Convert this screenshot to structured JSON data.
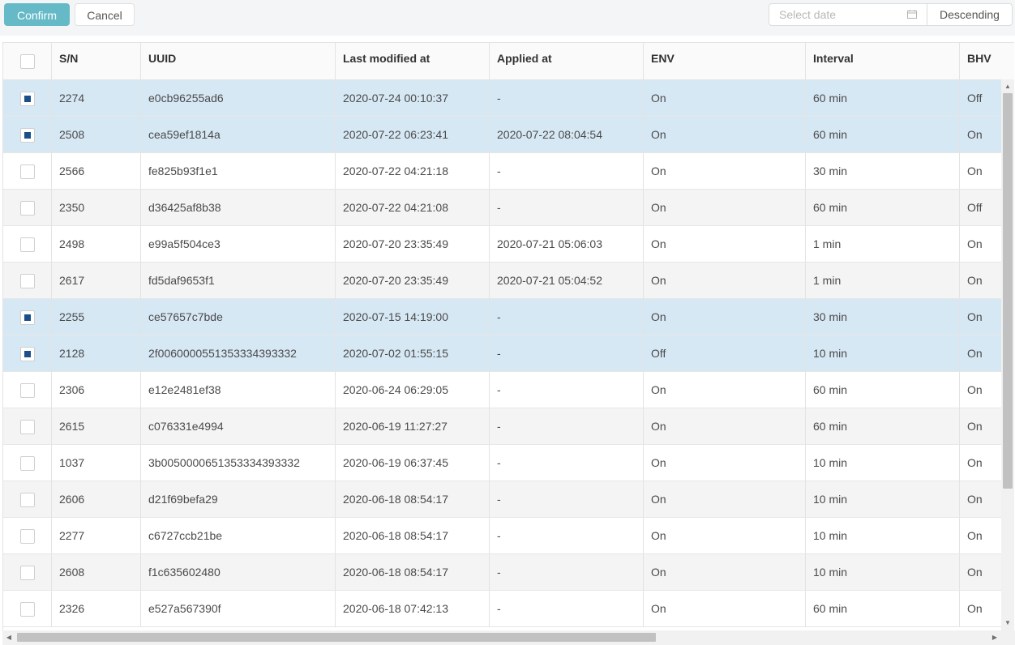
{
  "toolbar": {
    "confirm_label": "Confirm",
    "cancel_label": "Cancel",
    "date_placeholder": "Select date",
    "sort_label": "Descending"
  },
  "table": {
    "columns": [
      "S/N",
      "UUID",
      "Last modified at",
      "Applied at",
      "ENV",
      "Interval",
      "BHV"
    ],
    "rows": [
      {
        "selected": true,
        "sn": "2274",
        "uuid": "e0cb96255ad6",
        "modified": "2020-07-24 00:10:37",
        "applied": "-",
        "env": "On",
        "interval": "60 min",
        "bhv": "Off"
      },
      {
        "selected": true,
        "sn": "2508",
        "uuid": "cea59ef1814a",
        "modified": "2020-07-22 06:23:41",
        "applied": "2020-07-22 08:04:54",
        "env": "On",
        "interval": "60 min",
        "bhv": "On"
      },
      {
        "selected": false,
        "sn": "2566",
        "uuid": "fe825b93f1e1",
        "modified": "2020-07-22 04:21:18",
        "applied": "-",
        "env": "On",
        "interval": "30 min",
        "bhv": "On"
      },
      {
        "selected": false,
        "sn": "2350",
        "uuid": "d36425af8b38",
        "modified": "2020-07-22 04:21:08",
        "applied": "-",
        "env": "On",
        "interval": "60 min",
        "bhv": "Off"
      },
      {
        "selected": false,
        "sn": "2498",
        "uuid": "e99a5f504ce3",
        "modified": "2020-07-20 23:35:49",
        "applied": "2020-07-21 05:06:03",
        "env": "On",
        "interval": "1 min",
        "bhv": "On"
      },
      {
        "selected": false,
        "sn": "2617",
        "uuid": "fd5daf9653f1",
        "modified": "2020-07-20 23:35:49",
        "applied": "2020-07-21 05:04:52",
        "env": "On",
        "interval": "1 min",
        "bhv": "On"
      },
      {
        "selected": true,
        "sn": "2255",
        "uuid": "ce57657c7bde",
        "modified": "2020-07-15 14:19:00",
        "applied": "-",
        "env": "On",
        "interval": "30 min",
        "bhv": "On"
      },
      {
        "selected": true,
        "sn": "2128",
        "uuid": "2f0060000551353334393332",
        "modified": "2020-07-02 01:55:15",
        "applied": "-",
        "env": "Off",
        "interval": "10 min",
        "bhv": "On"
      },
      {
        "selected": false,
        "sn": "2306",
        "uuid": "e12e2481ef38",
        "modified": "2020-06-24 06:29:05",
        "applied": "-",
        "env": "On",
        "interval": "60 min",
        "bhv": "On"
      },
      {
        "selected": false,
        "sn": "2615",
        "uuid": "c076331e4994",
        "modified": "2020-06-19 11:27:27",
        "applied": "-",
        "env": "On",
        "interval": "60 min",
        "bhv": "On"
      },
      {
        "selected": false,
        "sn": "1037",
        "uuid": "3b0050000651353334393332",
        "modified": "2020-06-19 06:37:45",
        "applied": "-",
        "env": "On",
        "interval": "10 min",
        "bhv": "On"
      },
      {
        "selected": false,
        "sn": "2606",
        "uuid": "d21f69befa29",
        "modified": "2020-06-18 08:54:17",
        "applied": "-",
        "env": "On",
        "interval": "10 min",
        "bhv": "On"
      },
      {
        "selected": false,
        "sn": "2277",
        "uuid": "c6727ccb21be",
        "modified": "2020-06-18 08:54:17",
        "applied": "-",
        "env": "On",
        "interval": "10 min",
        "bhv": "On"
      },
      {
        "selected": false,
        "sn": "2608",
        "uuid": "f1c635602480",
        "modified": "2020-06-18 08:54:17",
        "applied": "-",
        "env": "On",
        "interval": "10 min",
        "bhv": "On"
      },
      {
        "selected": false,
        "sn": "2326",
        "uuid": "e527a567390f",
        "modified": "2020-06-18 07:42:13",
        "applied": "-",
        "env": "On",
        "interval": "60 min",
        "bhv": "On"
      }
    ]
  },
  "icons": {
    "calendar": "calendar-icon",
    "scroll_up": "arrow-up-icon",
    "scroll_down": "arrow-down-icon",
    "scroll_left": "arrow-left-icon",
    "scroll_right": "arrow-right-icon"
  },
  "colors": {
    "confirm_bg": "#66bac8",
    "selected_row": "#d7e8f5",
    "checkbox_mark": "#1a4f8a"
  }
}
